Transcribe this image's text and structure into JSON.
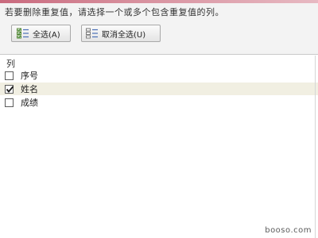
{
  "dialog": {
    "instruction": "若要删除重复值，请选择一个或多个包含重复值的列。"
  },
  "buttons": {
    "select_all": {
      "label": "全选(A)",
      "icon": "select-all-icon"
    },
    "deselect_all": {
      "label": "取消全选(U)",
      "icon": "deselect-all-icon"
    }
  },
  "list": {
    "header": "列",
    "items": [
      {
        "label": "序号",
        "checked": false
      },
      {
        "label": "姓名",
        "checked": true
      },
      {
        "label": "成绩",
        "checked": false
      }
    ]
  },
  "watermark": "booso.com"
}
